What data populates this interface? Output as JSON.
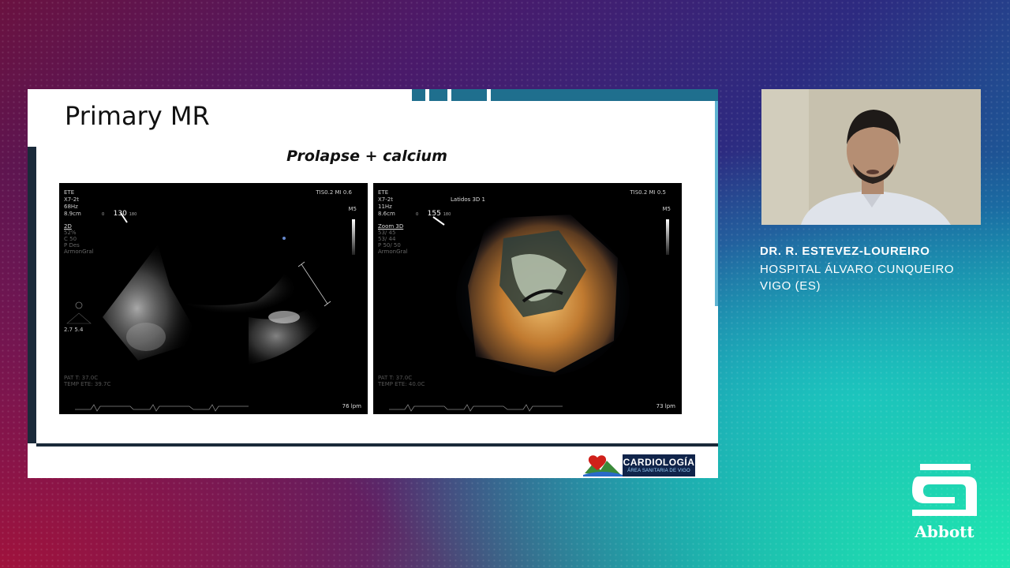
{
  "slide": {
    "title": "Primary MR",
    "subtitle": "Prolapse + calcium",
    "footer_logo": {
      "line1": "CARDIOLOGÍA",
      "line2": "ÁREA SANITARIA DE VIGO"
    }
  },
  "echo_left": {
    "top_left": [
      "ETE",
      "X7-2t",
      "68Hz",
      "8.9cm"
    ],
    "top_right": "TIS0.2   MI 0.6",
    "angle": "130",
    "angle_min": "0",
    "angle_max": "180",
    "mode": [
      "2D",
      "52%",
      "C 50",
      "P Des",
      "ArmonGral"
    ],
    "m5": "M5",
    "probe_values": "2.7   5.4",
    "temp": [
      "PAT T: 37.0C",
      "TEMP ETE: 39.7C"
    ],
    "bpm": "76 lpm"
  },
  "echo_right": {
    "top_left": [
      "ETE",
      "X7-2t",
      "11Hz",
      "8.6cm"
    ],
    "top_right": "TIS0.2   MI 0.5",
    "header": "Latidos 3D 1",
    "angle": "155",
    "angle_min": "0",
    "angle_max": "180",
    "mode": [
      "Zoom 3D",
      "53/ 45",
      "53/ 44",
      "P 50/ 50",
      "ArmonGral"
    ],
    "m5": "M5",
    "temp": [
      "PAT T: 37.0C",
      "TEMP ETE: 40.0C"
    ],
    "bpm": "73 lpm"
  },
  "speaker": {
    "name": "DR. R. ESTEVEZ-LOUREIRO",
    "hospital_line1": "HOSPITAL ÁLVARO CUNQUEIRO",
    "hospital_line2": "VIGO (ES)"
  },
  "brand": {
    "name": "Abbott"
  },
  "colors": {
    "slide_accent": "#1f6f8e",
    "logo_box": "#10244a"
  }
}
